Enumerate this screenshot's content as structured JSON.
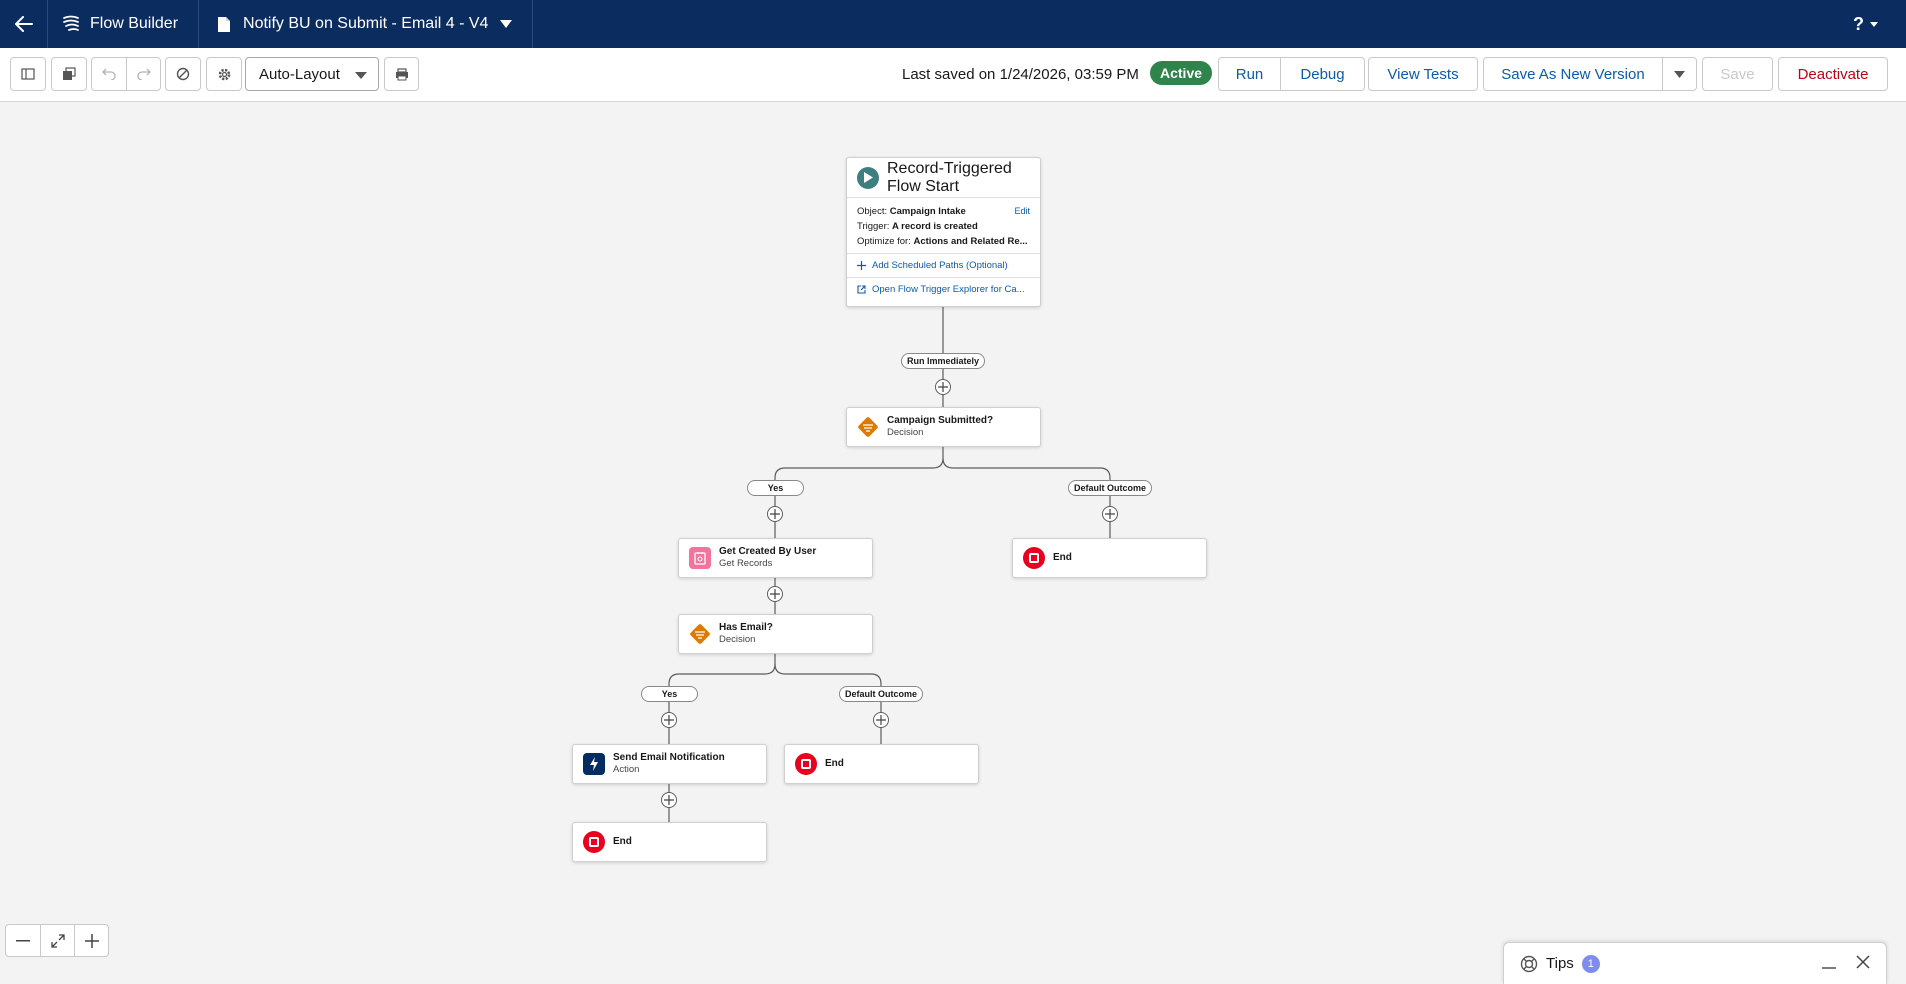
{
  "header": {
    "app_name": "Flow Builder",
    "flow_title": "Notify BU on Submit - Email 4 - V4",
    "help_label": "?"
  },
  "toolbar": {
    "layout_select": "Auto-Layout",
    "last_saved": "Last saved on 1/24/2026, 03:59 PM",
    "status": "Active",
    "run": "Run",
    "debug": "Debug",
    "view_tests": "View Tests",
    "save_as_new": "Save As New Version",
    "save": "Save",
    "deactivate": "Deactivate"
  },
  "start": {
    "title": "Record-Triggered Flow",
    "subtitle": "Start",
    "object_label": "Object:",
    "object_value": "Campaign Intake",
    "edit": "Edit",
    "trigger_label": "Trigger:",
    "trigger_value": "A record is created",
    "optimize_label": "Optimize for:",
    "optimize_value": "Actions and Related Re...",
    "add_paths": "Add Scheduled Paths (Optional)",
    "open_explorer": "Open Flow Trigger Explorer for Ca..."
  },
  "labels": {
    "run_immediately": "Run Immediately",
    "yes1": "Yes",
    "default1": "Default Outcome",
    "yes2": "Yes",
    "default2": "Default Outcome"
  },
  "nodes": {
    "decision1": {
      "title": "Campaign Submitted?",
      "subtitle": "Decision"
    },
    "get_records": {
      "title": "Get Created By User",
      "subtitle": "Get Records"
    },
    "end1": {
      "title": "End"
    },
    "decision2": {
      "title": "Has Email?",
      "subtitle": "Decision"
    },
    "action": {
      "title": "Send Email Notification",
      "subtitle": "Action"
    },
    "end2": {
      "title": "End"
    },
    "end3": {
      "title": "End"
    }
  },
  "tips": {
    "label": "Tips",
    "count": "1"
  },
  "colors": {
    "header_bg": "#0b2c5e",
    "active_badge": "#2e844a",
    "link": "#0b5cab",
    "decision": "#dd7a01",
    "end": "#ea001e",
    "start_icon": "#3d7e80",
    "get_records_icon": "#f2749c",
    "action_icon": "#032d60"
  }
}
